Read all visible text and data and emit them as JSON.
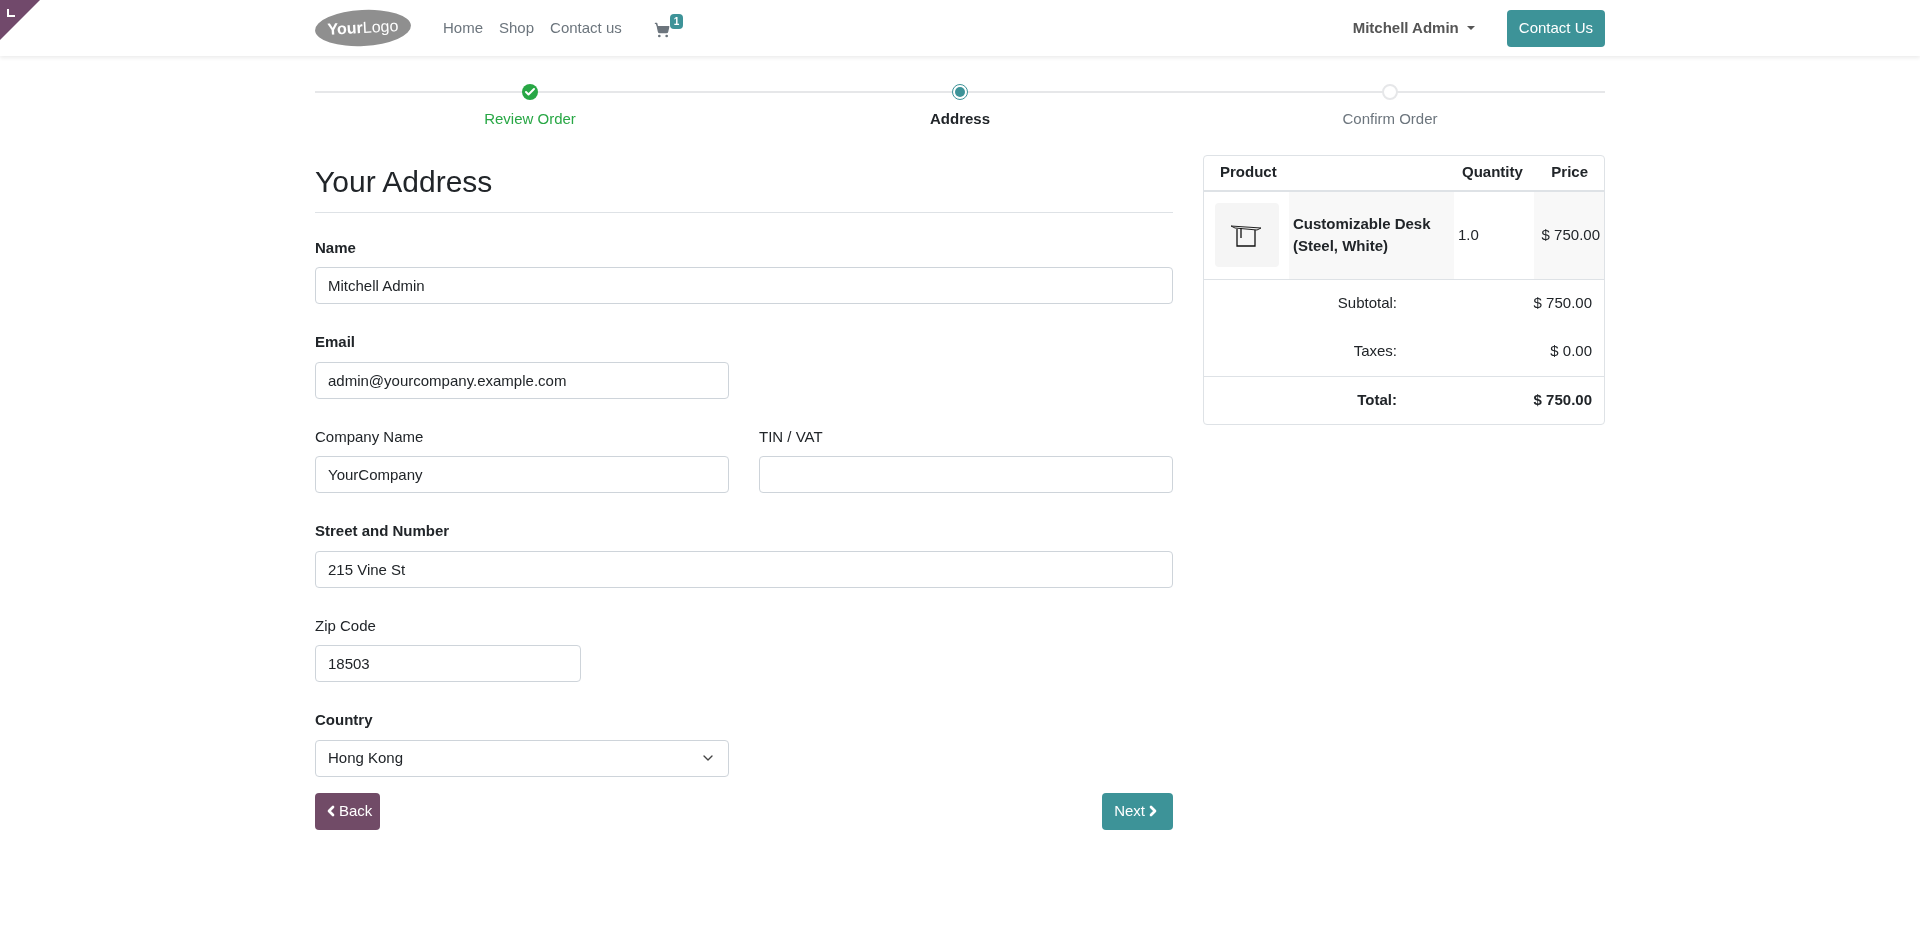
{
  "logo": {
    "bold_part": "Your",
    "light_part": "Logo"
  },
  "nav": {
    "links": [
      {
        "label": "Home"
      },
      {
        "label": "Shop"
      },
      {
        "label": "Contact us"
      }
    ],
    "cart_count": "1",
    "user": "Mitchell Admin",
    "cta": "Contact Us"
  },
  "steps": [
    {
      "label": "Review Order",
      "completed": true,
      "selected": false
    },
    {
      "label": "Address",
      "completed": false,
      "selected": true
    },
    {
      "label": "Confirm Order",
      "completed": false,
      "selected": false
    }
  ],
  "form": {
    "title": "Your Address",
    "rows": [
      {
        "fields": [
          {
            "label": "Name",
            "required": true,
            "value": "Mitchell Admin",
            "kind": "wide"
          }
        ]
      },
      {
        "fields": [
          {
            "label": "Email",
            "required": true,
            "value": "admin@yourcompany.example.com",
            "kind": "half"
          }
        ]
      },
      {
        "fields": [
          {
            "label": "Company Name",
            "required": false,
            "value": "YourCompany",
            "kind": "half"
          },
          {
            "label": "TIN / VAT",
            "required": false,
            "kind": "half"
          }
        ]
      },
      {
        "fields": [
          {
            "label": "Street and Number",
            "required": true,
            "value": "215 Vine St",
            "kind": "wide"
          }
        ]
      },
      {
        "fields": [
          {
            "label": "Zip Code",
            "required": false,
            "value": "18503",
            "kind": "short"
          }
        ]
      },
      {
        "fields": [
          {
            "label": "Country",
            "required": true,
            "value": "Hong Kong",
            "kind": "dropdown"
          }
        ]
      }
    ],
    "back_button": "Back",
    "next_button": "Next"
  },
  "summary": {
    "columns": [
      "Product",
      "Quantity",
      "Price"
    ],
    "rows": [
      {
        "product": "Customizable Desk (Steel, White)",
        "quantity": "1.0",
        "price": "$ 750.00"
      }
    ],
    "totals": [
      {
        "label": "Subtotal:",
        "value": "$ 750.00",
        "emphasis": false
      },
      {
        "label": "Taxes:",
        "value": "$ 0.00",
        "emphasis": false
      },
      {
        "label": "Total:",
        "value": "$ 750.00",
        "emphasis": true
      }
    ]
  }
}
